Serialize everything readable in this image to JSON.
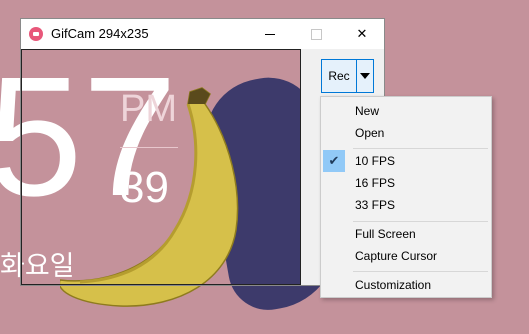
{
  "wallpaper": {
    "clock_big": "57",
    "clock_ampm": "PM",
    "clock_seconds": "39",
    "clock_day": "화요일",
    "background_color": "#c4929b",
    "banana_color": "#d6c04a"
  },
  "window": {
    "title": "GifCam 294x235",
    "app_icon": "gifcam-icon",
    "controls": {
      "minimize_icon": "minimize-icon",
      "maximize_icon": "maximize-icon",
      "close_glyph": "✕"
    },
    "rec_button_label": "Rec",
    "rec_dropdown_icon": "triangle-down-icon"
  },
  "menu": {
    "items": [
      {
        "label": "New",
        "checked": false
      },
      {
        "label": "Open",
        "checked": false
      },
      {
        "label": "10 FPS",
        "checked": true
      },
      {
        "label": "16 FPS",
        "checked": false
      },
      {
        "label": "33 FPS",
        "checked": false
      },
      {
        "label": "Full Screen",
        "checked": false
      },
      {
        "label": "Capture Cursor",
        "checked": false
      },
      {
        "label": "Customization",
        "checked": false
      }
    ],
    "check_glyph": "✔",
    "accent_color": "#91c9f7"
  }
}
